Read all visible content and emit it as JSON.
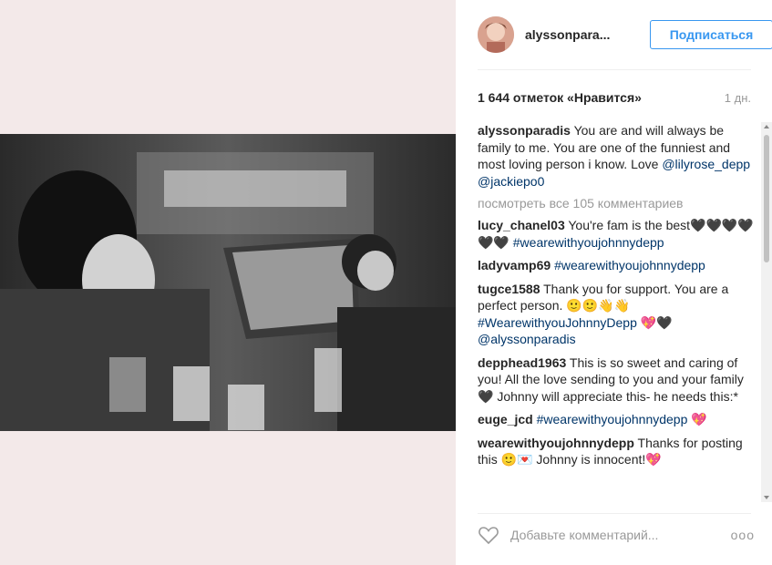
{
  "post": {
    "username": "alyssonpara...",
    "follow_label": "Подписаться",
    "likes": "1 644 отметок «Нравится»",
    "time": "1 дн."
  },
  "caption": {
    "user": "alyssonparadis",
    "text": " You are and will always be family to me. You are one of the funniest and most loving person i know. Love ",
    "mention1": "@lilyrose_depp",
    "mention2": "@jackiepo0"
  },
  "more_comments": "посмотреть все 105 комментариев",
  "comments": [
    {
      "user": "lucy_chanel03",
      "text": " You're fam is the best🖤🖤🖤🖤🖤🖤 ",
      "link": "#wearewithyoujohnnydepp"
    },
    {
      "user": "ladyvamp69",
      "text": " ",
      "link": "#wearewithyoujohnnydepp"
    },
    {
      "user": "tugce1588",
      "text": " Thank you for support. You are a perfect person. 🙂🙂👋👋 ",
      "link": "#WearewithyouJohnnyDepp",
      "tail": " 💖🖤 ",
      "link2": "@alyssonparadis"
    },
    {
      "user": "depphead1963",
      "text": " This is so sweet and caring of you! All the love sending to you and your family 🖤 Johnny will appreciate this- he needs this:*"
    },
    {
      "user": "euge_jcd",
      "text": " ",
      "link": "#wearewithyoujohnnydepp",
      "tail": " 💖"
    },
    {
      "user": "wearewithyoujohnnydepp",
      "text": " Thanks for posting this 🙂💌 Johnny is innocent!💖"
    }
  ],
  "add_comment_placeholder": "Добавьте комментарий...",
  "more_options": "ооо",
  "colors": {
    "accent": "#3897f0",
    "link": "#003569",
    "muted": "#999999"
  }
}
